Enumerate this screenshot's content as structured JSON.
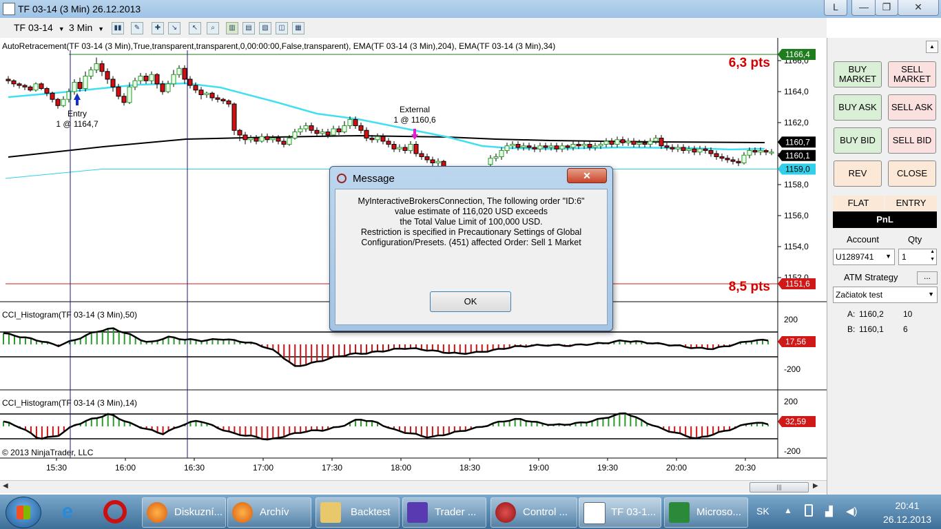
{
  "window": {
    "title": "TF 03-14 (3 Min)  26.12.2013",
    "l_button": "L",
    "minimize": "—",
    "maximize": "❐",
    "close": "✕"
  },
  "toolbar": {
    "instrument": "TF 03-14",
    "interval": "3 Min"
  },
  "chart": {
    "indicators_label": "AutoRetracement(TF  03-14  (3  Min),True,transparent,transparent,0,00:00:00,False,transparent),  EMA(TF  03-14  (3  Min),204),  EMA(TF  03-14  (3  Min),34)",
    "top_pts": "6,3 pts",
    "bottom_pts": "8,5 pts",
    "price_ticks": [
      "1166,0",
      "1164,0",
      "1162,0",
      "1160,0",
      "1158,0",
      "1156,0",
      "1154,0",
      "1152,0"
    ],
    "price_flags": {
      "upper_line": "1166,4",
      "last_a": "1160,7",
      "last_b": "1160,1",
      "cyan_line": "1159,0",
      "lower_line": "1151,6"
    },
    "entry_label": "Entry",
    "entry_detail": "1 @ 1164,7",
    "external_label": "External",
    "external_detail": "1 @ 1160,6",
    "cci1_label": "CCI_Histogram(TF  03-14  (3 Min),50)",
    "cci1_value": "17,56",
    "cci2_label": "CCI_Histogram(TF  03-14  (3 Min),14)",
    "cci2_value": "32,59",
    "cci_ticks": [
      "200",
      "-200"
    ],
    "copyright": "© 2013 NinjaTrader, LLC",
    "time_ticks": [
      "15:30",
      "16:00",
      "16:30",
      "17:00",
      "17:30",
      "18:00",
      "18:30",
      "19:00",
      "19:30",
      "20:00",
      "20:30"
    ],
    "colors": {
      "up": "#2a9a2a",
      "down": "#d01010",
      "ema_fast": "#40e0f0",
      "ema_slow": "#000000",
      "flag_green": "#1e7e1e",
      "flag_red": "#d01818",
      "flag_cyan": "#30d0e8"
    }
  },
  "panel": {
    "buy_market": "BUY MARKET",
    "sell_market": "SELL MARKET",
    "buy_ask": "BUY ASK",
    "sell_ask": "SELL ASK",
    "buy_bid": "BUY BID",
    "sell_bid": "SELL BID",
    "rev": "REV",
    "close": "CLOSE",
    "flat": "FLAT",
    "entry": "ENTRY",
    "pnl": "PnL",
    "account_label": "Account",
    "qty_label": "Qty",
    "account_value": "U1289741",
    "qty_value": "1",
    "atm_label": "ATM Strategy",
    "atm_dots": "...",
    "atm_value": "Začiatok test",
    "quote_a_label": "A:",
    "quote_a_price": "1160,2",
    "quote_a_size": "10",
    "quote_b_label": "B:",
    "quote_b_price": "1160,1",
    "quote_b_size": "6"
  },
  "dialog": {
    "title": "Message",
    "lines": [
      "MyInteractiveBrokersConnection, The following order \"ID:6\"",
      "value estimate of 116,020 USD exceeds",
      "the Total Value Limit of 100,000 USD.",
      "Restriction is specified in Precautionary Settings of Global",
      "Configuration/Presets. (451) affected Order: Sell 1 Market"
    ],
    "ok": "OK",
    "close": "✕"
  },
  "taskbar": {
    "items": [
      "Diskuzní...",
      "Archív",
      "Backtest",
      "Trader ...",
      "Control ...",
      "TF 03-1...",
      "Microso..."
    ],
    "lang": "SK",
    "time": "20:41",
    "date": "26.12.2013"
  }
}
